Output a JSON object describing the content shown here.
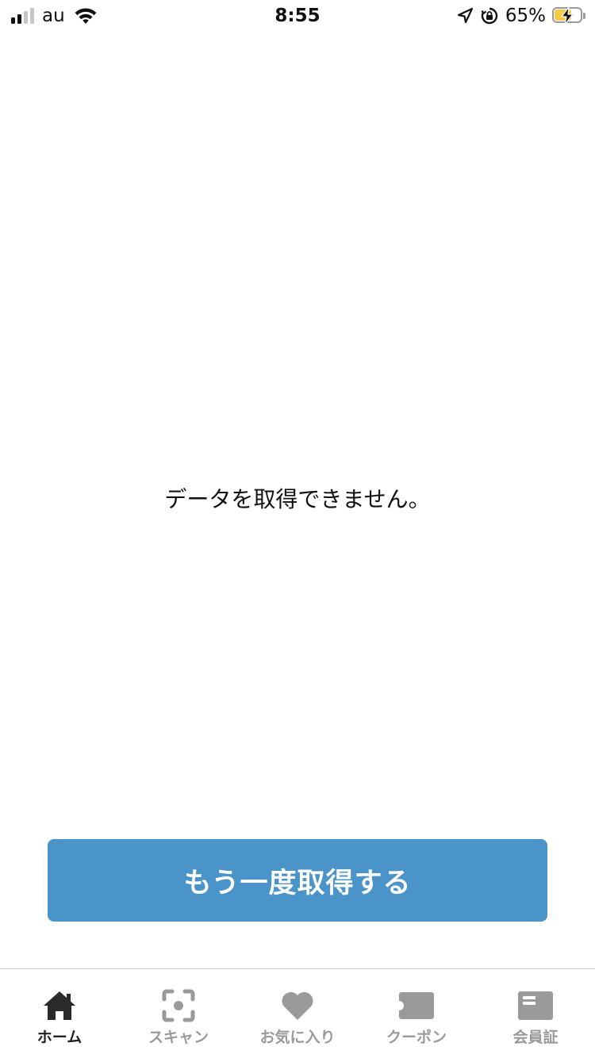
{
  "status_bar": {
    "carrier": "au",
    "time": "8:55",
    "battery_percent": "65%",
    "battery_level": 0.65,
    "signal_bars_active": 2,
    "signal_bars_total": 4,
    "icons": [
      "signal-icon",
      "wifi-icon",
      "location-arrow-icon",
      "orientation-lock-icon",
      "battery-charging-icon"
    ]
  },
  "main": {
    "error_message": "データを取得できません。",
    "retry_button_label": "もう一度取得する"
  },
  "tab_bar": {
    "active_tab": "home",
    "tabs": [
      {
        "id": "home",
        "label": "ホーム",
        "icon": "home-icon"
      },
      {
        "id": "scan",
        "label": "スキャン",
        "icon": "scan-icon"
      },
      {
        "id": "favorites",
        "label": "お気に入り",
        "icon": "heart-icon"
      },
      {
        "id": "coupon",
        "label": "クーポン",
        "icon": "ticket-icon"
      },
      {
        "id": "member-card",
        "label": "会員証",
        "icon": "member-card-icon"
      }
    ]
  },
  "colors": {
    "button_bg": "#4a94c9",
    "button_text": "#ffffff",
    "tab_active": "#222222",
    "tab_inactive": "#9a9a9a",
    "battery_fill": "#f7c948"
  }
}
